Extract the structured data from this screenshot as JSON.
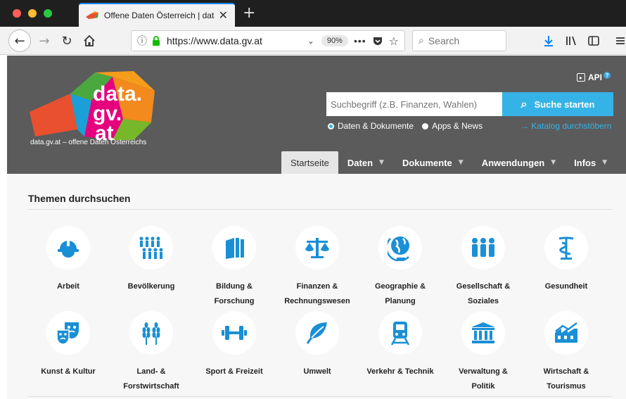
{
  "browser": {
    "tab_title": "Offene Daten Österreich | data.g",
    "url": "https://www.data.gv.at",
    "zoom": "90%",
    "search_placeholder": "Search"
  },
  "site": {
    "logo_line1": "data.",
    "logo_line2": "gv.",
    "logo_line3": "at",
    "tagline": "data.gv.at – offene Daten Österreichs",
    "api_label": "API",
    "search_placeholder": "Suchbegriff (z.B. Finanzen, Wahlen)",
    "search_button": "Suche starten",
    "radio_docs": "Daten & Dokumente",
    "radio_apps": "Apps & News",
    "catalog_link": "→ Katalog durchstöbern",
    "nav": [
      {
        "label": "Startseite"
      },
      {
        "label": "Daten"
      },
      {
        "label": "Dokumente"
      },
      {
        "label": "Anwendungen"
      },
      {
        "label": "Infos"
      }
    ]
  },
  "themes": {
    "title": "Themen durchsuchen",
    "items": [
      {
        "line1": "Arbeit",
        "line2": "",
        "icon": "helmet-icon"
      },
      {
        "line1": "Bevölkerung",
        "line2": "",
        "icon": "population-icon"
      },
      {
        "line1": "Bildung &",
        "line2": "Forschung",
        "icon": "books-icon"
      },
      {
        "line1": "Finanzen &",
        "line2": "Rechnungswesen",
        "icon": "scales-icon"
      },
      {
        "line1": "Geographie &",
        "line2": "Planung",
        "icon": "globe-icon"
      },
      {
        "line1": "Gesellschaft &",
        "line2": "Soziales",
        "icon": "people-icon"
      },
      {
        "line1": "Gesundheit",
        "line2": "",
        "icon": "caduceus-icon"
      },
      {
        "line1": "Kunst & Kultur",
        "line2": "",
        "icon": "masks-icon"
      },
      {
        "line1": "Land- &",
        "line2": "Forstwirtschaft",
        "icon": "wheat-icon"
      },
      {
        "line1": "Sport & Freizeit",
        "line2": "",
        "icon": "dumbbell-icon"
      },
      {
        "line1": "Umwelt",
        "line2": "",
        "icon": "leaf-icon"
      },
      {
        "line1": "Verkehr & Technik",
        "line2": "",
        "icon": "train-icon"
      },
      {
        "line1": "Verwaltung &",
        "line2": "Politik",
        "icon": "building-icon"
      },
      {
        "line1": "Wirtschaft &",
        "line2": "Tourismus",
        "icon": "factory-icon"
      }
    ]
  },
  "colors": {
    "accent": "#1a8fd6",
    "header_bg": "#5b5b5b",
    "search_button": "#36b3e6"
  }
}
